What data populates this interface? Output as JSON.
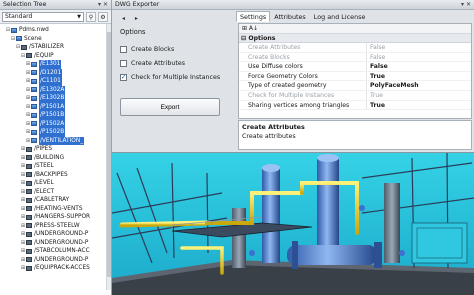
{
  "left_pane": {
    "title": "Selection Tree",
    "title_buttons": "▾ ✕",
    "mode_select": "Standard",
    "tree": [
      {
        "label": "Pdms.nwd",
        "indent": 1,
        "twisty": "⊟",
        "icon": "file",
        "selected": false
      },
      {
        "label": "Scene",
        "indent": 2,
        "twisty": "⊟",
        "icon": "file",
        "selected": false
      },
      {
        "label": "/STABILIZER",
        "indent": 3,
        "twisty": "⊟",
        "icon": "folder",
        "selected": false
      },
      {
        "label": "/EQUIP",
        "indent": 4,
        "twisty": "⊟",
        "icon": "folder",
        "selected": false
      },
      {
        "label": "/E1301",
        "indent": 5,
        "twisty": "⊞",
        "icon": "file",
        "selected": true
      },
      {
        "label": "/D1201",
        "indent": 5,
        "twisty": "⊞",
        "icon": "file",
        "selected": true
      },
      {
        "label": "/C1101",
        "indent": 5,
        "twisty": "⊞",
        "icon": "file",
        "selected": true
      },
      {
        "label": "/E1302A",
        "indent": 5,
        "twisty": "⊞",
        "icon": "file",
        "selected": true
      },
      {
        "label": "/E1302B",
        "indent": 5,
        "twisty": "⊞",
        "icon": "file",
        "selected": true
      },
      {
        "label": "/P1501A",
        "indent": 5,
        "twisty": "⊞",
        "icon": "file",
        "selected": true
      },
      {
        "label": "/P1501B",
        "indent": 5,
        "twisty": "⊞",
        "icon": "file",
        "selected": true
      },
      {
        "label": "/P1502A",
        "indent": 5,
        "twisty": "⊞",
        "icon": "file",
        "selected": true
      },
      {
        "label": "/P1502B",
        "indent": 5,
        "twisty": "⊞",
        "icon": "file",
        "selected": true
      },
      {
        "label": "/VENTILATION_",
        "indent": 5,
        "twisty": "⊞",
        "icon": "file",
        "selected": true
      },
      {
        "label": "/PIPES",
        "indent": 4,
        "twisty": "⊞",
        "icon": "folder",
        "selected": false
      },
      {
        "label": "/BUILDING",
        "indent": 4,
        "twisty": "⊞",
        "icon": "folder",
        "selected": false
      },
      {
        "label": "/STEEL",
        "indent": 4,
        "twisty": "⊞",
        "icon": "folder",
        "selected": false
      },
      {
        "label": "/BACKPIPES",
        "indent": 4,
        "twisty": "⊞",
        "icon": "folder",
        "selected": false
      },
      {
        "label": "/LEVEL",
        "indent": 4,
        "twisty": "⊞",
        "icon": "folder",
        "selected": false
      },
      {
        "label": "/ELECT",
        "indent": 4,
        "twisty": "⊞",
        "icon": "folder",
        "selected": false
      },
      {
        "label": "/CABLETRAY",
        "indent": 4,
        "twisty": "⊞",
        "icon": "folder",
        "selected": false
      },
      {
        "label": "/HEATING-VENTS",
        "indent": 4,
        "twisty": "⊞",
        "icon": "folder",
        "selected": false
      },
      {
        "label": "/HANGERS-SUPPOR",
        "indent": 4,
        "twisty": "⊞",
        "icon": "folder",
        "selected": false
      },
      {
        "label": "/PRESS-STEELW",
        "indent": 4,
        "twisty": "⊞",
        "icon": "folder",
        "selected": false
      },
      {
        "label": "/UNDERGROUND-P",
        "indent": 4,
        "twisty": "⊞",
        "icon": "folder",
        "selected": false
      },
      {
        "label": "/UNDERGROUND-P",
        "indent": 4,
        "twisty": "⊞",
        "icon": "folder",
        "selected": false
      },
      {
        "label": "/STABCOLUMN-ACC",
        "indent": 4,
        "twisty": "⊞",
        "icon": "folder",
        "selected": false
      },
      {
        "label": "/UNDERGROUND-P",
        "indent": 4,
        "twisty": "⊞",
        "icon": "folder",
        "selected": false
      },
      {
        "label": "/EQUIPRACK-ACCES",
        "indent": 4,
        "twisty": "⊞",
        "icon": "folder",
        "selected": false
      }
    ]
  },
  "exporter": {
    "title": "DWG Exporter",
    "title_buttons": "▾ ✕",
    "nav_arrows": "◂ ▸",
    "options_title": "Options",
    "checkboxes": [
      {
        "label": "Create Blocks",
        "checked": false
      },
      {
        "label": "Create Attributes",
        "checked": false
      },
      {
        "label": "Check for Multiple Instances",
        "checked": true
      }
    ],
    "export_label": "Export",
    "tabs": [
      {
        "label": "Settings",
        "active": true
      },
      {
        "label": "Attributes",
        "active": false
      },
      {
        "label": "Log and License",
        "active": false
      }
    ],
    "grid_toolbar_icons": "⊞ A↓",
    "category": "⊟ Options",
    "properties": [
      {
        "name": "Create Attributes",
        "value": "False",
        "disabled": true,
        "bold": false
      },
      {
        "name": "Create Blocks",
        "value": "False",
        "disabled": true,
        "bold": false
      },
      {
        "name": "Use Diffuse colors",
        "value": "False",
        "disabled": false,
        "bold": true
      },
      {
        "name": "Force Geometry Colors",
        "value": "True",
        "disabled": false,
        "bold": true
      },
      {
        "name": "Type of created geometry",
        "value": "PolyFaceMesh",
        "disabled": false,
        "bold": true
      },
      {
        "name": "Check for Multiple Instances",
        "value": "True",
        "disabled": true,
        "bold": false
      },
      {
        "name": "Sharing vertices among triangles",
        "value": "True",
        "disabled": false,
        "bold": true
      }
    ],
    "description": {
      "title": "Create Attributes",
      "text": "Create attributes"
    }
  },
  "colors": {
    "selection": "#2f6fd0",
    "viewport_cyan": "#2fc8e0",
    "pipe_yellow": "#e8d020",
    "equipment_blue": "#4a78c8"
  }
}
